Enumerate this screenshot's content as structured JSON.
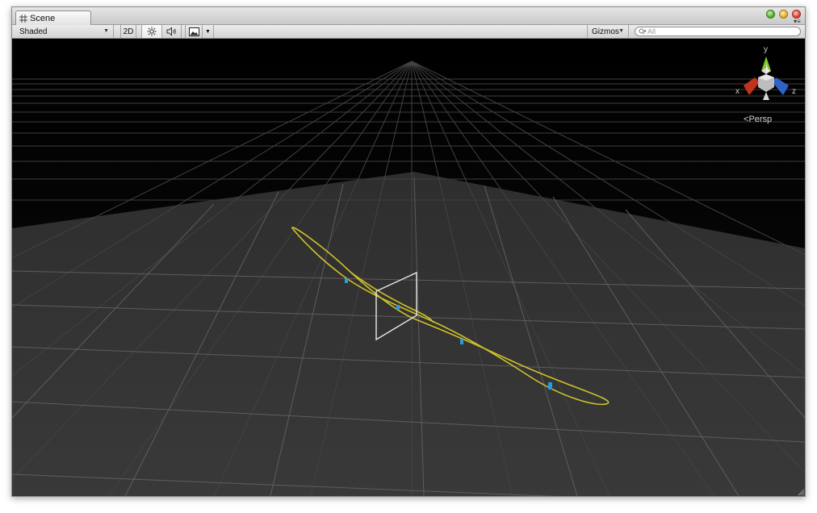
{
  "window": {
    "tab_title": "Scene",
    "tab_icon": "scene-grid-icon"
  },
  "toolbar": {
    "draw_mode": "Shaded",
    "mode_2d_label": "2D",
    "lighting_icon": "sun-icon",
    "audio_icon": "speaker-icon",
    "effects_icon": "image-icon",
    "gizmos_label": "Gizmos",
    "search_placeholder": "All"
  },
  "viewport": {
    "projection_label": "Persp",
    "gizmo_axes": {
      "x": "x",
      "y": "y",
      "z": "z"
    },
    "colors": {
      "background_top": "#000000",
      "ground": "#3a3a3a",
      "grid_line": "#5a5a5a",
      "curve": "#cfc12a",
      "plane_outline": "#e8e8e8",
      "axis_x": "#c0331c",
      "axis_y": "#7ec92b",
      "axis_z": "#2f63c8",
      "point_marker": "#2a9be0"
    }
  }
}
